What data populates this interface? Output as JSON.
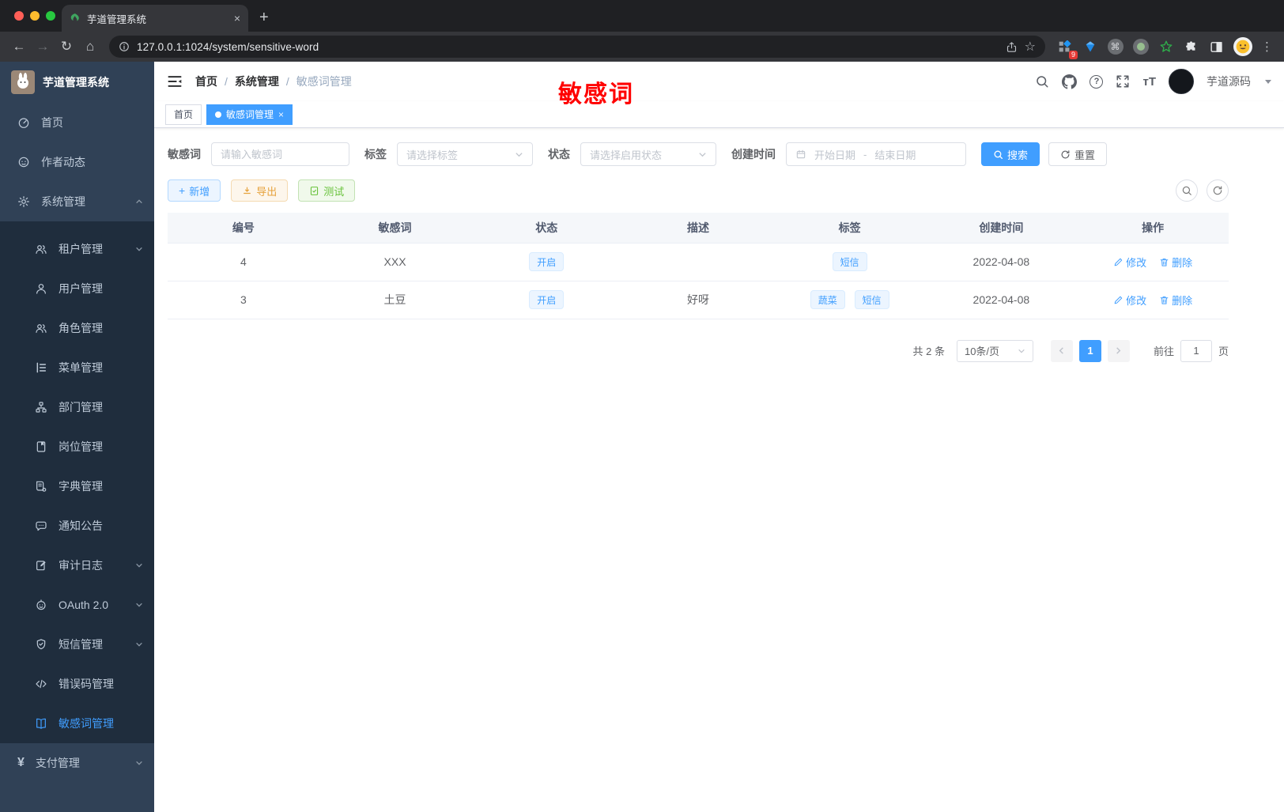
{
  "browser": {
    "tab_title": "芋道管理系统",
    "url": "127.0.0.1:1024/system/sensitive-word",
    "extension_badge": "9"
  },
  "glyphs": {
    "back": "←",
    "forward": "→",
    "reload": "↻",
    "home": "⌂",
    "close": "×",
    "plus": "+",
    "more": "⋮",
    "star": "☆",
    "question": "?",
    "command": "⌘",
    "font_size": "тT",
    "yen": "¥"
  },
  "sidebar": {
    "logo_title": "芋道管理系统",
    "items": [
      {
        "label": "首页"
      },
      {
        "label": "作者动态"
      },
      {
        "label": "系统管理"
      },
      {
        "label": "租户管理"
      },
      {
        "label": "用户管理"
      },
      {
        "label": "角色管理"
      },
      {
        "label": "菜单管理"
      },
      {
        "label": "部门管理"
      },
      {
        "label": "岗位管理"
      },
      {
        "label": "字典管理"
      },
      {
        "label": "通知公告"
      },
      {
        "label": "审计日志"
      },
      {
        "label": "OAuth 2.0"
      },
      {
        "label": "短信管理"
      },
      {
        "label": "错误码管理"
      },
      {
        "label": "敏感词管理"
      },
      {
        "label": "支付管理"
      }
    ]
  },
  "navbar": {
    "breadcrumb": [
      "首页",
      "系统管理",
      "敏感词管理"
    ],
    "separator": "/",
    "username": "芋道源码"
  },
  "annotation": {
    "text": "敏感词",
    "color": "#ff0000"
  },
  "tags_view": [
    {
      "label": "首页"
    },
    {
      "label": "敏感词管理"
    }
  ],
  "filters": {
    "keyword": {
      "label": "敏感词",
      "placeholder": "请输入敏感词",
      "value": ""
    },
    "tag": {
      "label": "标签",
      "placeholder": "请选择标签"
    },
    "status": {
      "label": "状态",
      "placeholder": "请选择启用状态"
    },
    "create_time": {
      "label": "创建时间",
      "start_placeholder": "开始日期",
      "separator": "-",
      "end_placeholder": "结束日期"
    },
    "search_label": "搜索",
    "reset_label": "重置"
  },
  "toolbar": {
    "add": "新增",
    "export": "导出",
    "test": "测试"
  },
  "table": {
    "columns": [
      "编号",
      "敏感词",
      "状态",
      "描述",
      "标签",
      "创建时间",
      "操作"
    ],
    "rows": [
      {
        "id": "4",
        "word": "XXX",
        "status": "开启",
        "description": "",
        "tags": [
          "短信"
        ],
        "create_time": "2022-04-08",
        "edit": "修改",
        "delete": "删除"
      },
      {
        "id": "3",
        "word": "土豆",
        "status": "开启",
        "description": "好呀",
        "tags": [
          "蔬菜",
          "短信"
        ],
        "create_time": "2022-04-08",
        "edit": "修改",
        "delete": "删除"
      }
    ]
  },
  "pagination": {
    "total": "共 2 条",
    "page_size": "10条/页",
    "current_page": "1",
    "goto_label": "前往",
    "goto_value": "1",
    "page_unit": "页"
  },
  "colors": {
    "accent": "#409eff",
    "sidebar_bg": "#304156",
    "submenu_bg": "#1f2d3d"
  }
}
